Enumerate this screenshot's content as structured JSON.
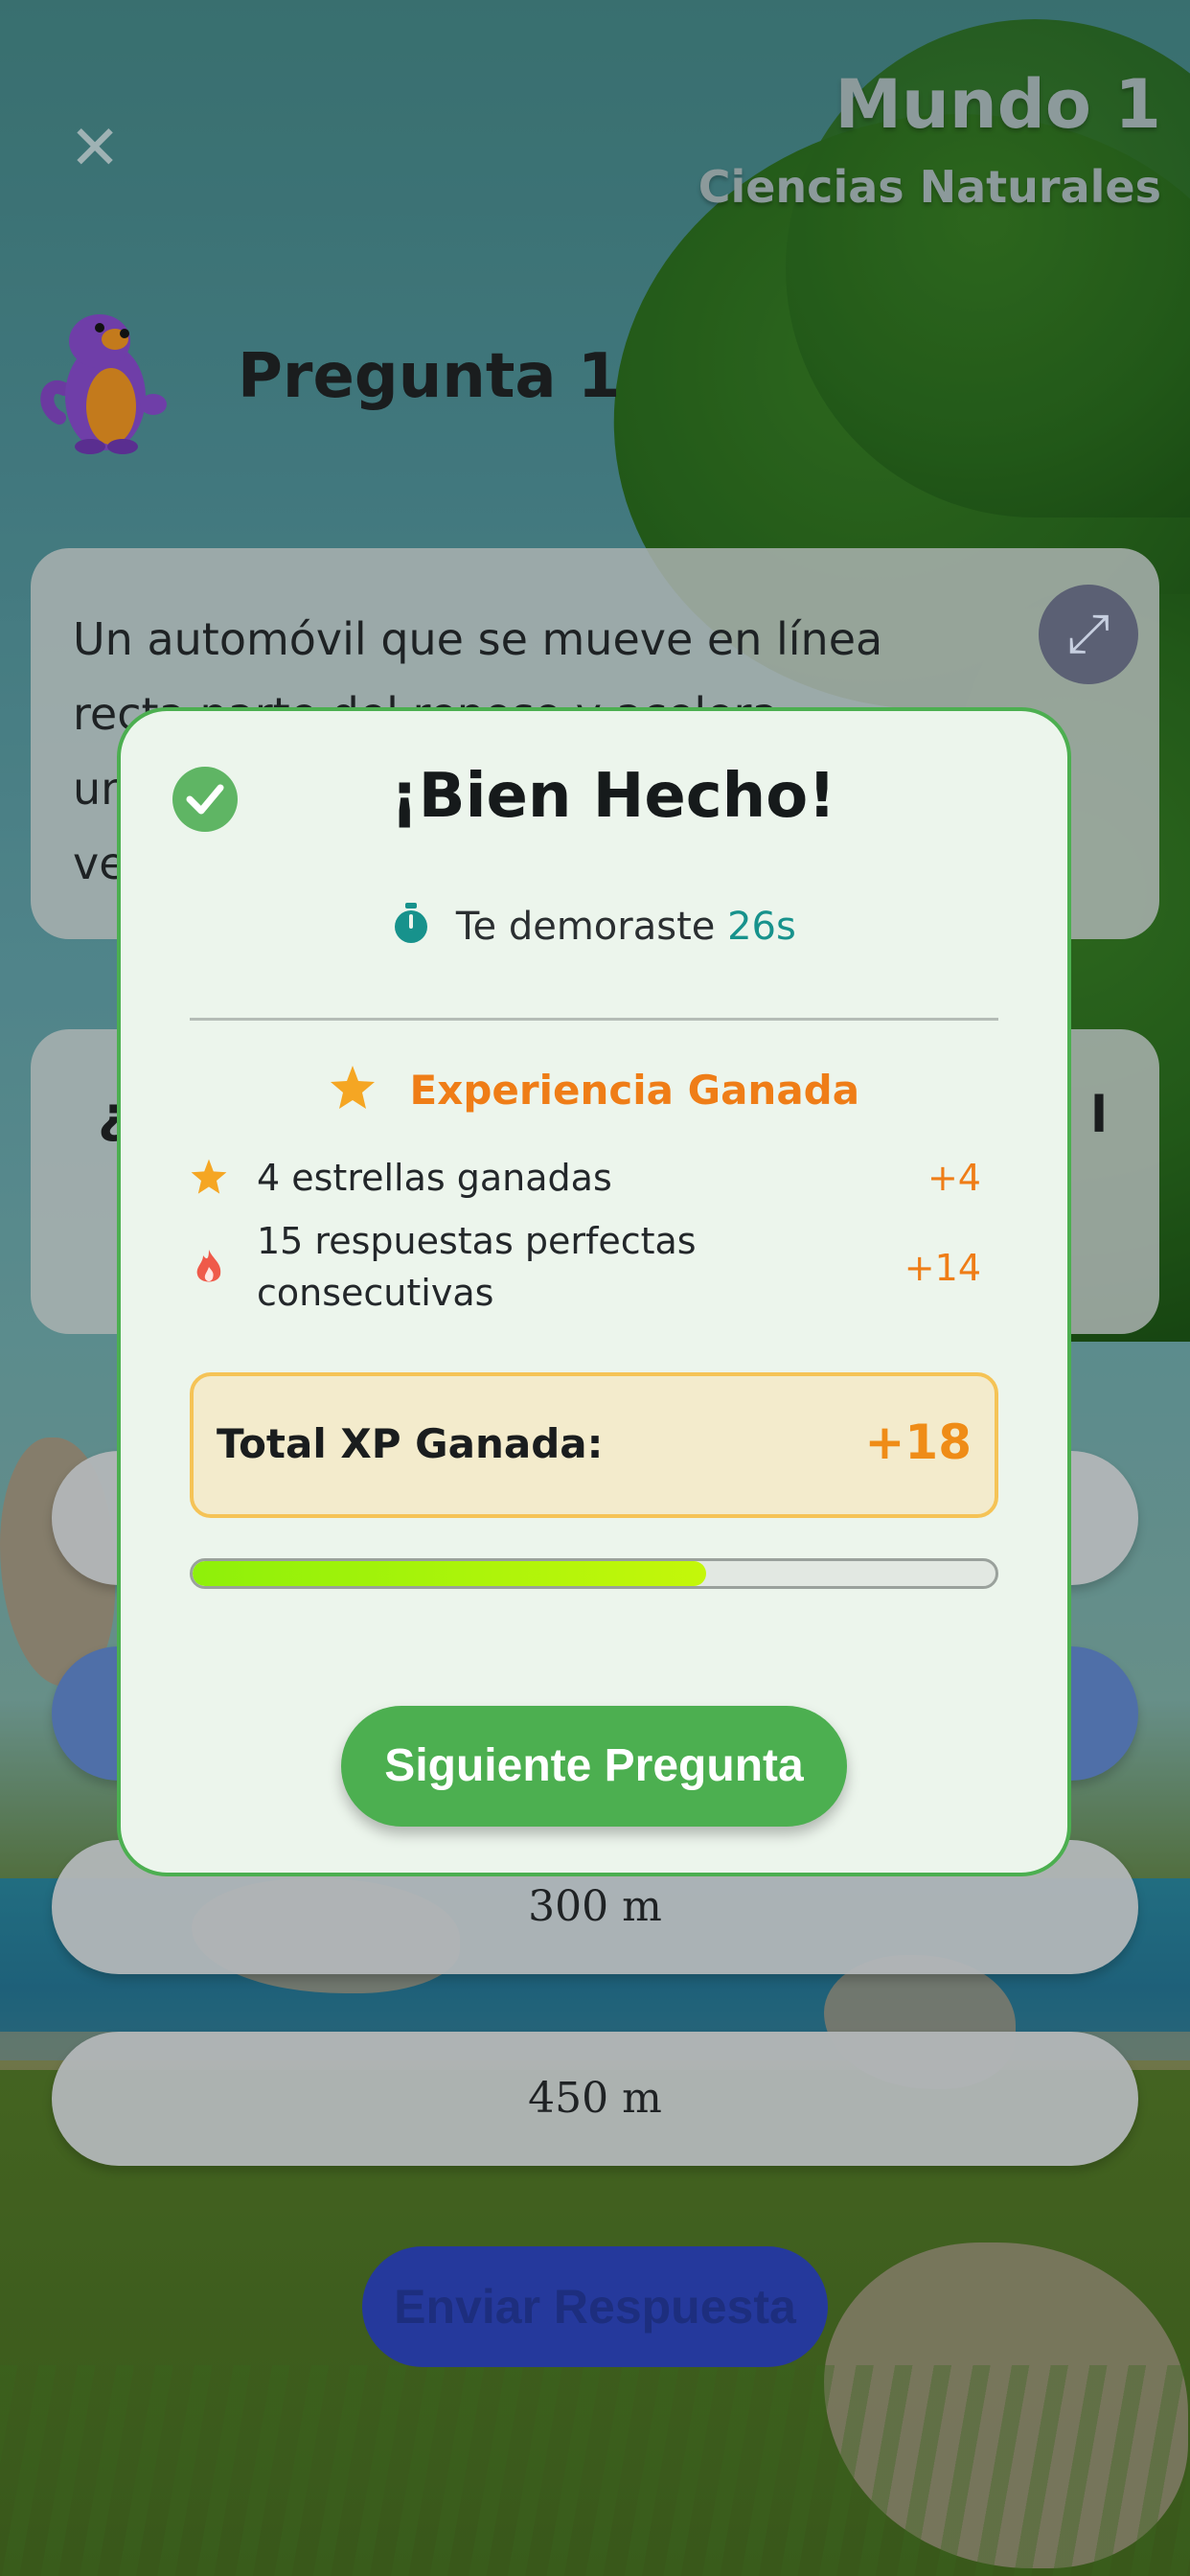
{
  "header": {
    "world_title": "Mundo 1",
    "world_subtitle": "Ciencias Naturales",
    "question_title": "Pregunta 1"
  },
  "question": {
    "text": "Un automóvil que se mueve en línea\nrecta parte del reposo y acelera\nun\nve"
  },
  "prompt": {
    "left_fragment": "¿",
    "right_fragment": "l"
  },
  "options": [
    "",
    "",
    "300 m",
    "450 m"
  ],
  "submit_label": "Enviar Respuesta",
  "modal": {
    "title": "¡Bien Hecho!",
    "time_prefix": "Te demoraste",
    "time_value": "26s",
    "xp_heading": "Experiencia Ganada",
    "rows": [
      {
        "icon": "star-icon",
        "label": "4 estrellas ganadas",
        "value": "+4"
      },
      {
        "icon": "fire-icon",
        "label": "15 respuestas perfectas consecutivas",
        "value": "+14"
      }
    ],
    "total_label": "Total XP Ganada:",
    "total_value": "+18",
    "progress_fraction": 0.64,
    "next_label": "Siguiente Pregunta"
  },
  "colors": {
    "accent_green": "#4caf50",
    "xp_orange": "#ef7d17",
    "time_teal": "#17928c",
    "submit_blue": "#25399c"
  }
}
